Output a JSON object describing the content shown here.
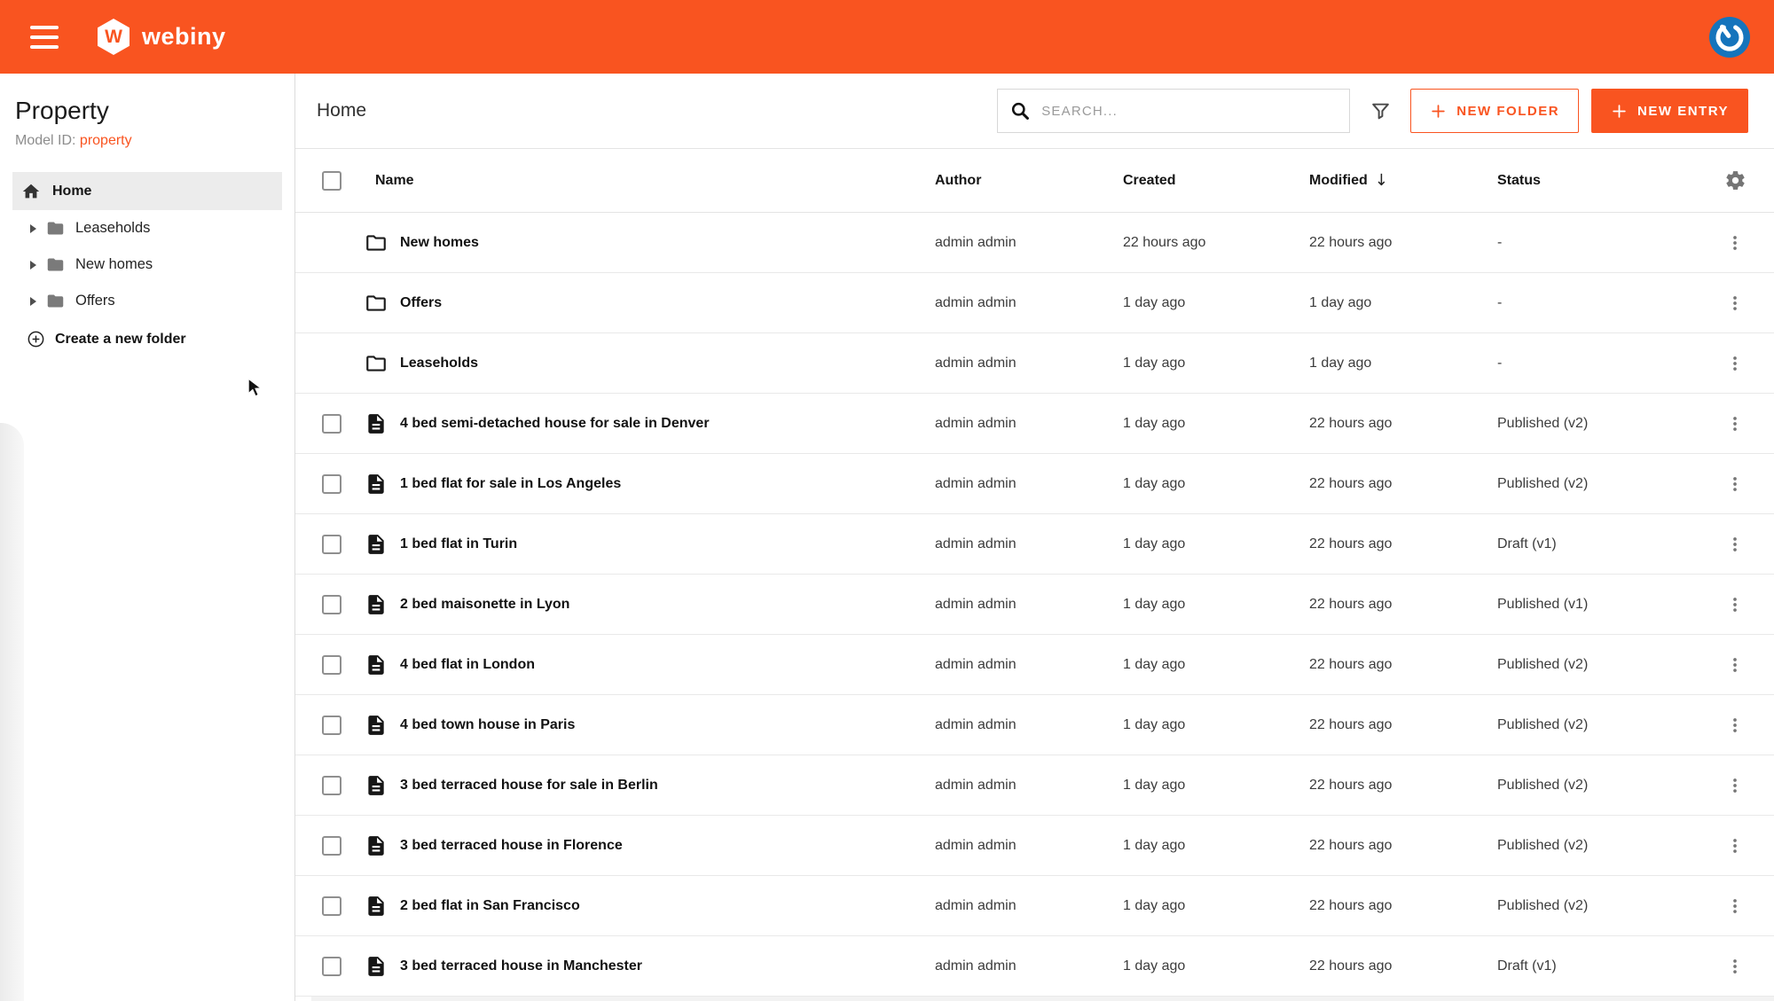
{
  "colors": {
    "accent": "#f95420",
    "avatar_blue": "#1574bc"
  },
  "topbar": {
    "menu_icon": "hamburger-icon",
    "logo_letter": "W",
    "brand": "webiny",
    "avatar_icon": "gravatar-icon"
  },
  "sidebar": {
    "title": "Property",
    "model_id_label": "Model ID:",
    "model_id_value": "property",
    "home_label": "Home",
    "folders": [
      {
        "label": "Leaseholds"
      },
      {
        "label": "New homes"
      },
      {
        "label": "Offers"
      }
    ],
    "create_folder_label": "Create a new folder"
  },
  "header": {
    "title": "Home",
    "search_placeholder": "SEARCH...",
    "new_folder_label": "NEW FOLDER",
    "new_entry_label": "NEW ENTRY"
  },
  "table": {
    "columns": [
      "Name",
      "Author",
      "Created",
      "Modified",
      "Status"
    ],
    "sort_column": "Modified",
    "sort_indicator": "↓",
    "rows": [
      {
        "type": "folder",
        "name": "New homes",
        "author": "admin admin",
        "created": "22 hours ago",
        "modified": "22 hours ago",
        "status": "-"
      },
      {
        "type": "folder",
        "name": "Offers",
        "author": "admin admin",
        "created": "1 day ago",
        "modified": "1 day ago",
        "status": "-"
      },
      {
        "type": "folder",
        "name": "Leaseholds",
        "author": "admin admin",
        "created": "1 day ago",
        "modified": "1 day ago",
        "status": "-"
      },
      {
        "type": "entry",
        "name": "4 bed semi-detached house for sale in Denver",
        "author": "admin admin",
        "created": "1 day ago",
        "modified": "22 hours ago",
        "status": "Published (v2)"
      },
      {
        "type": "entry",
        "name": "1 bed flat for sale in Los Angeles",
        "author": "admin admin",
        "created": "1 day ago",
        "modified": "22 hours ago",
        "status": "Published (v2)"
      },
      {
        "type": "entry",
        "name": "1 bed flat in Turin",
        "author": "admin admin",
        "created": "1 day ago",
        "modified": "22 hours ago",
        "status": "Draft (v1)"
      },
      {
        "type": "entry",
        "name": "2 bed maisonette in Lyon",
        "author": "admin admin",
        "created": "1 day ago",
        "modified": "22 hours ago",
        "status": "Published (v1)"
      },
      {
        "type": "entry",
        "name": "4 bed flat in London",
        "author": "admin admin",
        "created": "1 day ago",
        "modified": "22 hours ago",
        "status": "Published (v2)"
      },
      {
        "type": "entry",
        "name": "4 bed town house in Paris",
        "author": "admin admin",
        "created": "1 day ago",
        "modified": "22 hours ago",
        "status": "Published (v2)"
      },
      {
        "type": "entry",
        "name": "3 bed terraced house for sale in Berlin",
        "author": "admin admin",
        "created": "1 day ago",
        "modified": "22 hours ago",
        "status": "Published (v2)"
      },
      {
        "type": "entry",
        "name": "3 bed terraced house in Florence",
        "author": "admin admin",
        "created": "1 day ago",
        "modified": "22 hours ago",
        "status": "Published (v2)"
      },
      {
        "type": "entry",
        "name": "2 bed flat in San Francisco",
        "author": "admin admin",
        "created": "1 day ago",
        "modified": "22 hours ago",
        "status": "Published (v2)"
      },
      {
        "type": "entry",
        "name": "3 bed terraced house in Manchester",
        "author": "admin admin",
        "created": "1 day ago",
        "modified": "22 hours ago",
        "status": "Draft (v1)"
      }
    ]
  }
}
